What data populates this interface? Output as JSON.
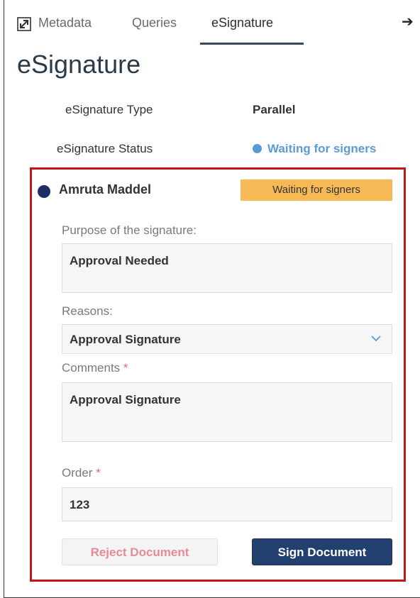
{
  "tabs": [
    {
      "label": "Metadata"
    },
    {
      "label": "Queries"
    },
    {
      "label": "eSignature"
    }
  ],
  "active_tab": "eSignature",
  "page_title": "eSignature",
  "info": {
    "type_label": "eSignature Type",
    "type_value": "Parallel",
    "status_label": "eSignature Status",
    "status_value": "Waiting for signers"
  },
  "signer": {
    "name": "Amruta Maddel",
    "badge": "Waiting for signers",
    "purpose_label": "Purpose of the signature:",
    "purpose_value": "Approval Needed",
    "reasons_label": "Reasons:",
    "reasons_value": "Approval Signature",
    "comments_label": "Comments",
    "comments_value": "Approval Signature",
    "order_label": "Order",
    "order_value": "123",
    "required_mark": "*"
  },
  "buttons": {
    "reject": "Reject Document",
    "sign": "Sign Document"
  },
  "colors": {
    "status_blue": "#5b9bd5",
    "badge_orange": "#f7b955",
    "highlight_red": "#c0161c",
    "sign_button": "#22406f",
    "reject_text": "#e58b96"
  }
}
